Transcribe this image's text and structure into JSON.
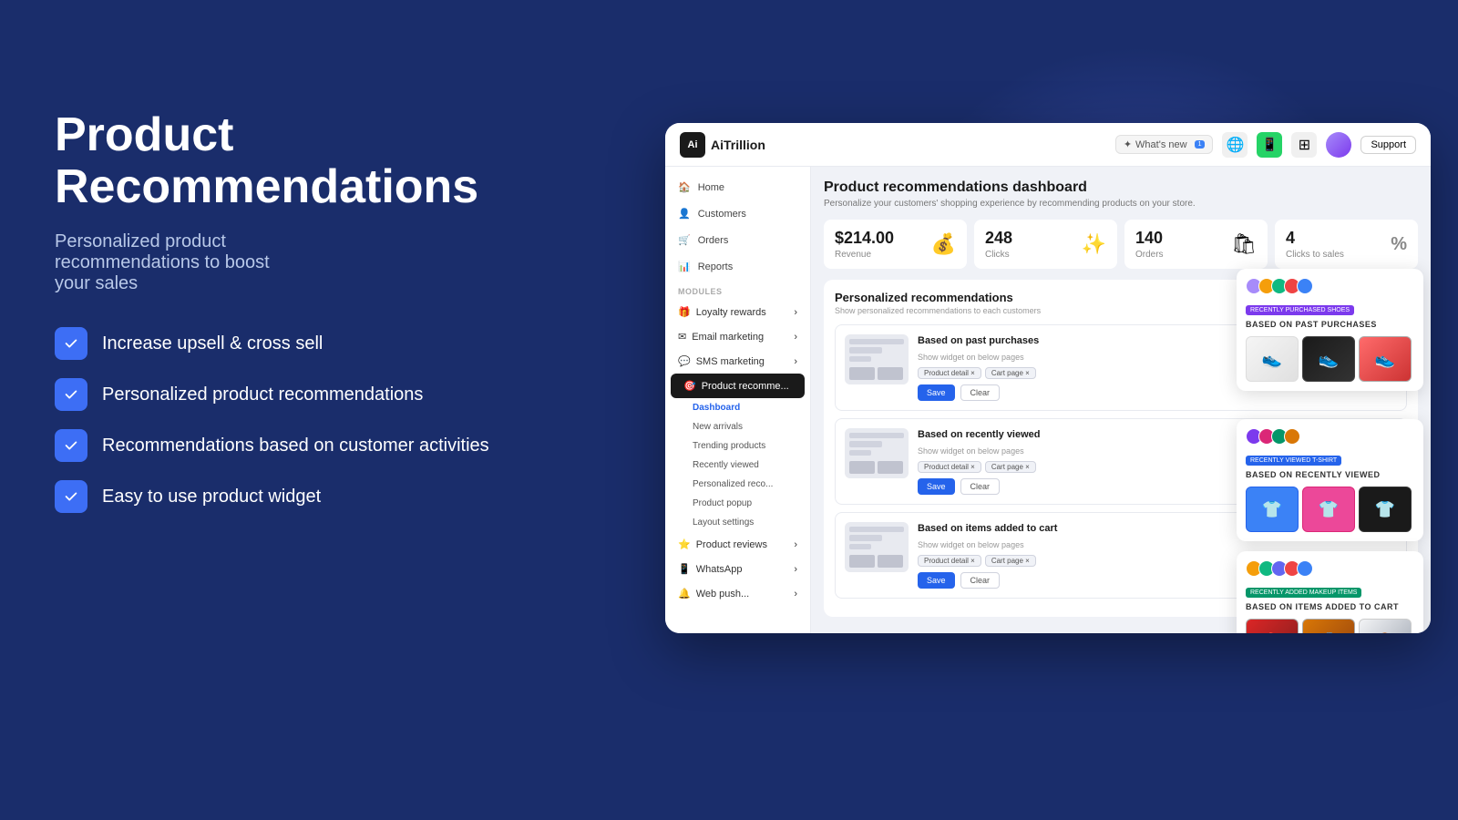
{
  "page": {
    "bg_color": "#1a2d6b"
  },
  "left": {
    "title": "Product\nRecommendations",
    "subtitle": "Personalized product\nrecommendations to boost\nyour sales",
    "features": [
      "Increase upsell & cross sell",
      "Personalized product recommendations",
      "Recommendations based on customer activities",
      "Easy to use product widget"
    ]
  },
  "nav": {
    "logo": "AiTrillion",
    "logo_short": "Ai",
    "whats_new": "What's new",
    "whats_new_badge": "1",
    "support": "Support"
  },
  "sidebar": {
    "top_items": [
      {
        "label": "Home",
        "icon": "home"
      },
      {
        "label": "Customers",
        "icon": "user"
      },
      {
        "label": "Orders",
        "icon": "cart"
      },
      {
        "label": "Reports",
        "icon": "bar-chart"
      }
    ],
    "modules_label": "MODULES",
    "modules": [
      {
        "label": "Loyalty rewards",
        "icon": "gift",
        "expandable": true
      },
      {
        "label": "Email marketing",
        "icon": "mail",
        "expandable": true
      },
      {
        "label": "SMS marketing",
        "icon": "chat",
        "expandable": true
      },
      {
        "label": "Product recomme...",
        "icon": "target",
        "active": true,
        "expandable": false
      }
    ],
    "sub_items": [
      {
        "label": "Dashboard",
        "active": true
      },
      {
        "label": "New arrivals"
      },
      {
        "label": "Trending products"
      },
      {
        "label": "Recently viewed"
      },
      {
        "label": "Personalized reco..."
      },
      {
        "label": "Product popup"
      },
      {
        "label": "Layout settings"
      }
    ],
    "bottom_modules": [
      {
        "label": "Product reviews",
        "icon": "star",
        "expandable": true
      },
      {
        "label": "WhatsApp",
        "icon": "whatsapp",
        "expandable": true
      },
      {
        "label": "Web push...",
        "icon": "bell",
        "expandable": true
      }
    ]
  },
  "content": {
    "title": "Product recommendations dashboard",
    "subtitle": "Personalize your customers' shopping experience by recommending products on your store.",
    "stats": [
      {
        "value": "$214.00",
        "label": "Revenue",
        "icon": "💰"
      },
      {
        "value": "248",
        "label": "Clicks",
        "icon": "✨"
      },
      {
        "value": "140",
        "label": "Orders",
        "icon": "🛍"
      },
      {
        "value": "4",
        "label": "Clicks to sales",
        "icon": "%"
      }
    ],
    "reco_section_title": "Personalized recommendations",
    "reco_section_subtitle": "Show personalized recommendations to each customers",
    "reco_cards": [
      {
        "title": "Based on past purchases",
        "desc": "Show widget on below pages",
        "tags": [
          "Product detail ×",
          "Cart page ×"
        ],
        "enabled": true
      },
      {
        "title": "Based on recently viewed",
        "desc": "Show widget on below pages",
        "tags": [
          "Product detail ×",
          "Cart page ×"
        ],
        "enabled": true
      },
      {
        "title": "Based on items added to cart",
        "desc": "Show widget on below pages",
        "tags": [
          "Product detail ×",
          "Cart page ×"
        ],
        "enabled": true
      }
    ],
    "save_label": "Save",
    "clear_label": "Clear"
  },
  "previews": {
    "past_purchases": {
      "title": "BASED ON PAST PURCHASES",
      "badge": "RECENTLY PURCHASED SHOES"
    },
    "recently_viewed": {
      "title": "BASED ON RECENTLY VIEWED",
      "badge": "RECENTLY VIEWED T-SHIRT"
    },
    "cart": {
      "title": "BASED ON ITEMS ADDED TO CART",
      "badge": "RECENTLY ADDED MAKEUP ITEMS"
    }
  }
}
